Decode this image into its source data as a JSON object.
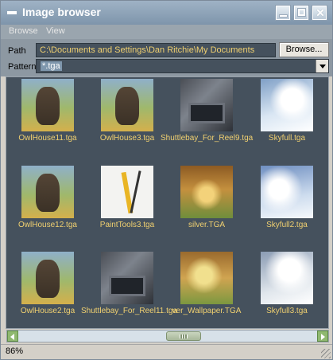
{
  "window": {
    "title": "Image browser"
  },
  "menu": {
    "items": [
      "Browse",
      "View"
    ]
  },
  "toolbar": {
    "path_label": "Path",
    "path_value": "C:\\Documents and Settings\\Dan Ritchie\\My Documents",
    "browse_label": "Browse...",
    "pattern_label": "Pattern",
    "pattern_value": "*.tga"
  },
  "thumbnails": [
    {
      "name": "OwlHouse11.tga",
      "icon": "owl-image"
    },
    {
      "name": "OwlHouse3.tga",
      "icon": "owl-image"
    },
    {
      "name": "Shuttlebay_For_Reel9.tga",
      "icon": "shuttlebay-image"
    },
    {
      "name": "Skyfull.tga",
      "icon": "sky-image"
    },
    {
      "name": "OwlHouse12.tga",
      "icon": "owl-image"
    },
    {
      "name": "PaintTools3.tga",
      "icon": "paint-tools-image"
    },
    {
      "name": "silver.TGA",
      "icon": "autumn-image"
    },
    {
      "name": "Skyfull2.tga",
      "icon": "sky-image"
    },
    {
      "name": "OwlHouse2.tga",
      "icon": "owl-image"
    },
    {
      "name": "Shuttlebay_For_Reel11.tga",
      "icon": "shuttlebay-image"
    },
    {
      "name": "ver_Wallpaper.TGA",
      "icon": "autumn-image"
    },
    {
      "name": "Skyfull3.tga",
      "icon": "sky-image"
    }
  ],
  "status": {
    "zoom": "86%"
  },
  "colors": {
    "titlebar": "#8aa0b5",
    "panel_bg": "#45515d",
    "caption_text": "#f0d070",
    "scrollbar_button": "#8fb870"
  }
}
